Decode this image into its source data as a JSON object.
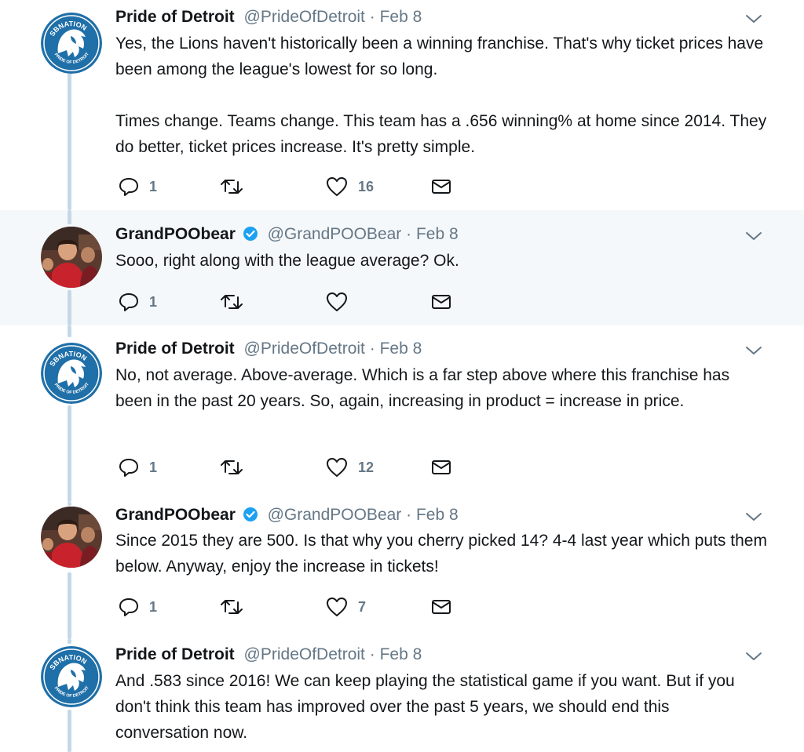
{
  "tweets": [
    {
      "name": "Pride of Detroit",
      "handle": "@PrideOfDetroit",
      "date": "Feb 8",
      "verified": false,
      "avatar": "sbnation-pride-of-detroit-logo",
      "lines": [
        "Yes, the Lions haven't historically been a winning franchise. That's why ticket prices have been among the league's lowest for so long.",
        "Times change. Teams change. This team has a .656 winning% at home since 2014. They do better, ticket prices increase. It's pretty simple."
      ],
      "replies": "1",
      "retweets": "",
      "likes": "16"
    },
    {
      "name": "GrandPOObear",
      "handle": "@GrandPOOBear",
      "date": "Feb 8",
      "verified": true,
      "avatar": "user-photo",
      "lines": [
        "Sooo, right along with the league average? Ok."
      ],
      "replies": "1",
      "retweets": "",
      "likes": ""
    },
    {
      "name": "Pride of Detroit",
      "handle": "@PrideOfDetroit",
      "date": "Feb 8",
      "verified": false,
      "avatar": "sbnation-pride-of-detroit-logo",
      "lines": [
        "No, not average. Above-average. Which is a far step above where this franchise has been in the past 20 years. So, again, increasing in product = increase in price."
      ],
      "replies": "1",
      "retweets": "",
      "likes": "12"
    },
    {
      "name": "GrandPOObear",
      "handle": "@GrandPOOBear",
      "date": "Feb 8",
      "verified": true,
      "avatar": "user-photo",
      "lines": [
        "Since 2015 they are 500. Is that why you cherry picked 14? 4-4 last year which puts them below. Anyway, enjoy the increase in tickets!"
      ],
      "replies": "1",
      "retweets": "",
      "likes": "7"
    },
    {
      "name": "Pride of Detroit",
      "handle": "@PrideOfDetroit",
      "date": "Feb 8",
      "verified": false,
      "avatar": "sbnation-pride-of-detroit-logo",
      "lines": [
        "And .583 since 2016! We can keep playing the statistical game if you want. But if you don't think this team has improved over the past 5 years, we should end this conversation now."
      ],
      "replies": "",
      "retweets": "",
      "likes": ""
    }
  ],
  "logo_text": {
    "top": "SBNATION",
    "bottom": "PRIDE OF DETROIT"
  },
  "colors": {
    "text": "#14171a",
    "muted": "#657786",
    "thread_line": "#c4d8e8",
    "highlight_bg": "#f5f8fa",
    "verified": "#1da1f2",
    "logo_blue": "#1f6fa8"
  }
}
